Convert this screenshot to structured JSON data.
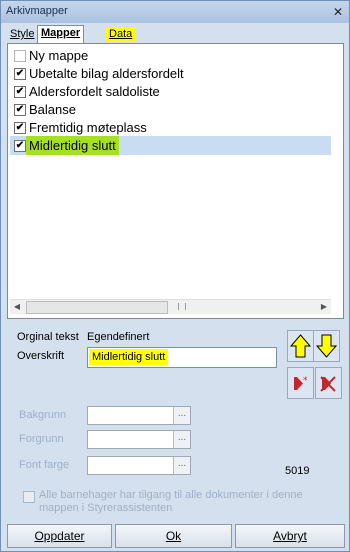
{
  "window": {
    "title": "Arkivmapper",
    "close_glyph": "✕"
  },
  "tabs": [
    {
      "label": "Style"
    },
    {
      "label": "Mapper"
    },
    {
      "label": "Data"
    }
  ],
  "list": {
    "items": [
      {
        "label": "Ny mappe",
        "checked": false,
        "mark": ""
      },
      {
        "label": "Ubetalte bilag aldersfordelt",
        "checked": true,
        "mark": "✔"
      },
      {
        "label": "Aldersfordelt saldoliste",
        "checked": true,
        "mark": "✔"
      },
      {
        "label": "Balanse",
        "checked": true,
        "mark": "✔"
      },
      {
        "label": "Fremtidig møteplass",
        "checked": true,
        "mark": "✔"
      },
      {
        "label": "Midlertidig slutt",
        "checked": true,
        "mark": "✔",
        "selected": true
      }
    ]
  },
  "scrollbar": {
    "left_arrow": "◀",
    "right_arrow": "▶"
  },
  "form": {
    "original_label": "Orginal tekst",
    "original_value": "Egendefinert",
    "heading_label": "Overskrift",
    "heading_value": "Midlertidig slutt",
    "background_label": "Bakgrunn",
    "foreground_label": "Forgrunn",
    "font_label": "Font farge",
    "ellipsis": "...",
    "number": "5019",
    "access_text": "Alle barnehager har tilgang til alle dokumenter i denne mappen i Styrerassistenten"
  },
  "icons": {
    "up": "arrow-up-icon",
    "down": "arrow-down-icon",
    "new": "new-folder-icon",
    "delete": "delete-folder-icon",
    "accent_yellow": "#ffff00",
    "accent_red": "#c0282e"
  },
  "buttons": {
    "update": "Oppdater",
    "ok": "Ok",
    "cancel": "Avbryt"
  }
}
